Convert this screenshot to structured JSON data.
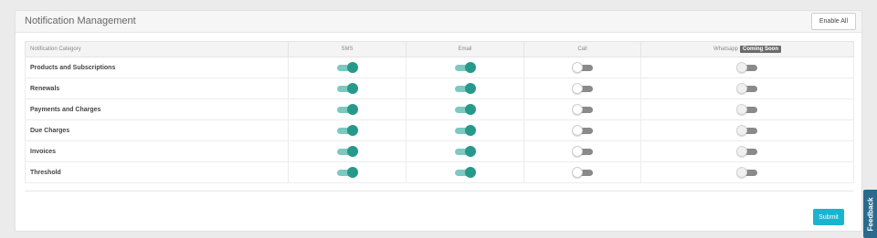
{
  "header": {
    "title": "Notification Management",
    "enable_all_label": "Enable All"
  },
  "table": {
    "columns": [
      "Notification Category",
      "SMS",
      "Email",
      "Call",
      "Whatsapp"
    ],
    "whatsapp_badge": "Coming Soon",
    "rows": [
      {
        "category": "Products and Subscriptions",
        "sms": true,
        "email": true,
        "call": false,
        "whatsapp": false
      },
      {
        "category": "Renewals",
        "sms": true,
        "email": true,
        "call": false,
        "whatsapp": false
      },
      {
        "category": "Payments and Charges",
        "sms": true,
        "email": true,
        "call": false,
        "whatsapp": false
      },
      {
        "category": "Due Charges",
        "sms": true,
        "email": true,
        "call": false,
        "whatsapp": false
      },
      {
        "category": "Invoices",
        "sms": true,
        "email": true,
        "call": false,
        "whatsapp": false
      },
      {
        "category": "Threshold",
        "sms": true,
        "email": true,
        "call": false,
        "whatsapp": false
      }
    ]
  },
  "footer": {
    "submit_label": "Submit"
  },
  "feedback_label": "Feedback",
  "colors": {
    "toggle_on_track": "#7cc9bf",
    "toggle_on_knob": "#26998a",
    "toggle_off_track": "#8a8a8a",
    "submit_bg": "#19b5cf",
    "feedback_bg": "#2a6a8f"
  }
}
